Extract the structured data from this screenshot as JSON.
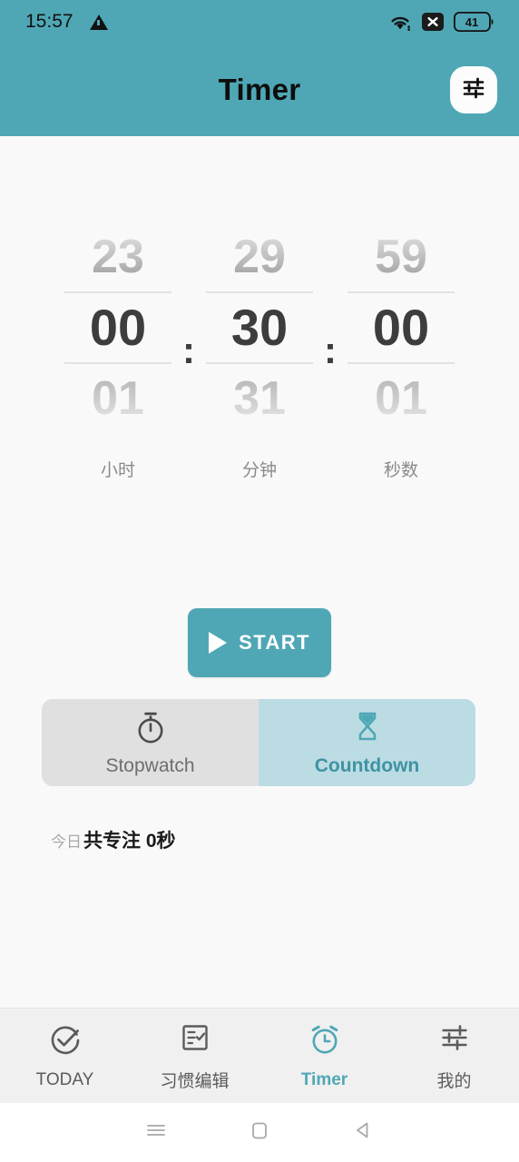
{
  "statusbar": {
    "time": "15:57",
    "warning_icon": "warning-triangle-icon",
    "wifi_icon": "wifi-icon",
    "nosim_icon": "no-sim-x-icon",
    "battery_level": "41"
  },
  "header": {
    "title": "Timer",
    "settings_icon": "tune-sliders-icon",
    "background_color": "#4FA7B5"
  },
  "picker": {
    "columns": [
      {
        "name": "hours",
        "prev": "23",
        "selected": "00",
        "next": "01",
        "label": "小时"
      },
      {
        "name": "minutes",
        "prev": "29",
        "selected": "30",
        "next": "31",
        "label": "分钟"
      },
      {
        "name": "seconds",
        "prev": "59",
        "selected": "00",
        "next": "01",
        "label": "秒数"
      }
    ],
    "separator": ":"
  },
  "start_button": {
    "label": "START",
    "icon": "play-icon",
    "color": "#4FA7B5"
  },
  "modes": [
    {
      "name": "stopwatch",
      "label": "Stopwatch",
      "icon": "stopwatch-icon",
      "active": false
    },
    {
      "name": "countdown",
      "label": "Countdown",
      "icon": "hourglass-icon",
      "active": true
    }
  ],
  "focus_summary": {
    "prefix": "今日",
    "text": "共专注 0秒"
  },
  "bottom_nav": [
    {
      "name": "today",
      "label": "TODAY",
      "icon": "check-circle-icon",
      "active": false
    },
    {
      "name": "habits",
      "label": "习惯编辑",
      "icon": "checklist-icon",
      "active": false
    },
    {
      "name": "timer",
      "label": "Timer",
      "icon": "alarm-clock-icon",
      "active": true
    },
    {
      "name": "mine",
      "label": "我的",
      "icon": "tune-sliders-icon",
      "active": false
    }
  ],
  "system_nav": {
    "recents_icon": "menu-lines-icon",
    "home_icon": "home-square-icon",
    "back_icon": "back-triangle-icon"
  },
  "colors": {
    "accent": "#4FA7B5",
    "accent_light": "#BCDCE3",
    "inactive_tab": "#E0E0E0",
    "page_background": "#F9F9F9"
  }
}
